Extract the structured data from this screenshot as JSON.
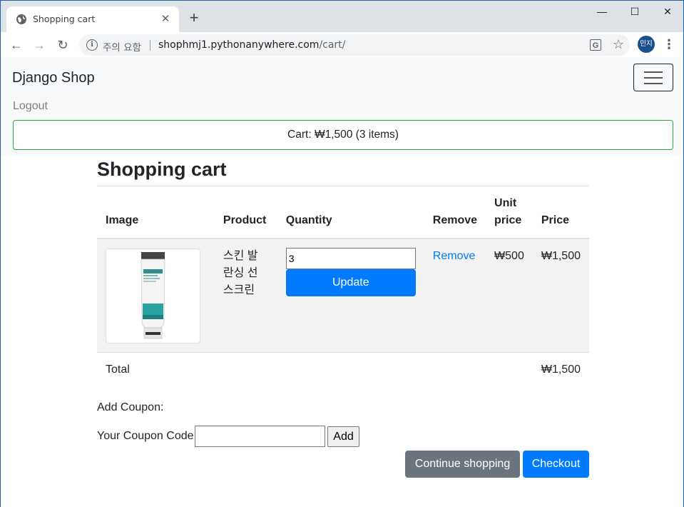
{
  "browser": {
    "tab_title": "Shopping cart",
    "tab_close": "✕",
    "new_tab": "+",
    "security_label": "주의 요함",
    "url_host": "shophmj1.pythonanywhere.com",
    "url_path": "/cart/",
    "profile_name": "민지",
    "window_controls": {
      "minimize": "—",
      "maximize": "☐",
      "close": "✕"
    }
  },
  "navbar": {
    "brand": "Django Shop",
    "logout": "Logout",
    "cart_summary": "Cart: ₩1,500 (3 items)"
  },
  "cart": {
    "title": "Shopping cart",
    "headers": {
      "image": "Image",
      "product": "Product",
      "quantity": "Quantity",
      "remove": "Remove",
      "unit_price": "Unit price",
      "price": "Price"
    },
    "items": [
      {
        "product": "스킨 발란싱 선스크린",
        "quantity": "3",
        "update_label": "Update",
        "remove_label": "Remove",
        "unit_price": "₩500",
        "price": "₩1,500"
      }
    ],
    "total_label": "Total",
    "total_value": "₩1,500"
  },
  "coupon": {
    "heading": "Add Coupon:",
    "label": "Your Coupon Code:",
    "value": "",
    "button": "Add"
  },
  "actions": {
    "continue": "Continue shopping",
    "checkout": "Checkout"
  },
  "colors": {
    "primary": "#007bff",
    "secondary": "#6c757d",
    "cart_border": "#28a745"
  }
}
